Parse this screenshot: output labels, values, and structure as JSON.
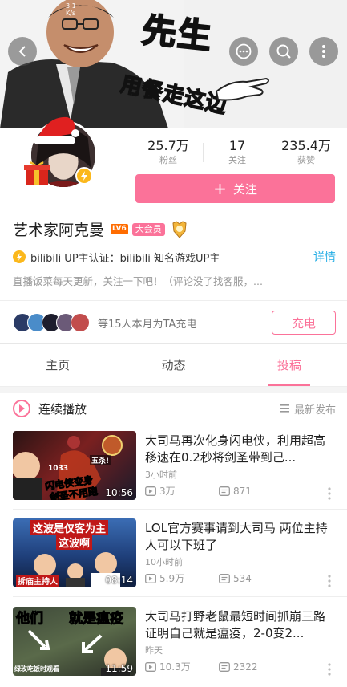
{
  "status": {
    "line1": "3.1",
    "line2": "K/s"
  },
  "banner": {
    "text_top": "先生",
    "text_bottom": "用餐走这边"
  },
  "stats": [
    {
      "num": "25.7万",
      "label": "粉丝"
    },
    {
      "num": "17",
      "label": "关注"
    },
    {
      "num": "235.4万",
      "label": "获赞"
    }
  ],
  "follow": {
    "plus": "+",
    "label": "关注"
  },
  "user": {
    "name": "艺术家阿克曼",
    "level": "LV6",
    "vip": "大会员"
  },
  "cert": {
    "text": "bilibili UP主认证：bilibili 知名游戏UP主",
    "detail": "详情"
  },
  "sign": "直播饭菜每天更新，关注一下吧！（评论没了找客服，...",
  "charge": {
    "text": "等15人本月为TA充电",
    "button": "充电"
  },
  "tabs": [
    {
      "label": "主页"
    },
    {
      "label": "动态"
    },
    {
      "label": "投稿"
    }
  ],
  "playlist": {
    "label": "连续播放",
    "sort": "最新发布"
  },
  "videos": [
    {
      "title": "大司马再次化身闪电侠，利用超高移速在0.2秒将剑圣带到己...",
      "time": "3小时前",
      "views": "3万",
      "comments": "871",
      "duration": "10:56",
      "thumb_text1": "闪电侠变身",
      "thumb_text2": "剑圣不用跑",
      "thumb_badge": "五杀!",
      "thumb_gold": "1033"
    },
    {
      "title": "LOL官方赛事请到大司马 两位主持人可以下班了",
      "time": "10小时前",
      "views": "5.9万",
      "comments": "534",
      "duration": "08:14",
      "thumb_text1": "这波是仅客为主",
      "thumb_text2": "这波啊",
      "thumb_badge": "拆庙主持人"
    },
    {
      "title": "大司马打野老鼠最短时间抓崩三路证明自己就是瘟疫，2-0变2...",
      "time": "昨天",
      "views": "10.3万",
      "comments": "2322",
      "duration": "11:59",
      "thumb_text1": "他们",
      "thumb_text2": "就是瘟疫",
      "thumb_badge": "绿玫吃饭时观看"
    }
  ],
  "colors": {
    "pink": "#fb7299",
    "blue": "#23ade5",
    "gold": "#fbb81c"
  }
}
